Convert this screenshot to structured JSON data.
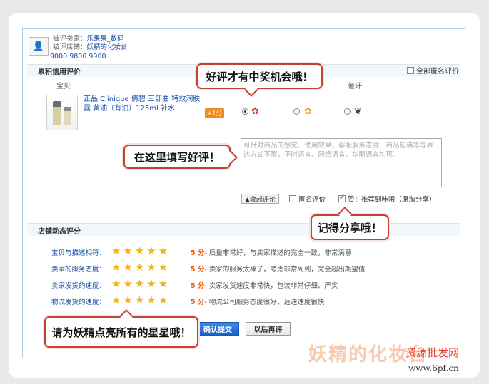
{
  "seller": {
    "seller_label": "被评卖家：",
    "seller_name": "乐果果_数码",
    "shop_label": "被评店铺：",
    "shop_name": "妖精的化妆台",
    "phones": "9000 9800 9900"
  },
  "credit_section": {
    "title": "累积信用评价",
    "anonymous_all": "全部匿名评价",
    "columns": [
      "宝贝",
      "差评"
    ]
  },
  "product": {
    "name": "正品 Clinique 倩碧 三部曲 特效润肤露 黄油（有油）125ml 补水",
    "bonus_badge": "+1分"
  },
  "review": {
    "placeholder": "可针对商品的感觉、使用效果、客服服务态度、商品包装等等表达方式不限，平时语言、网络语言、华丽语言均可.",
    "fold_button": "▲收起评论",
    "anonymous_label": "匿名评价",
    "share_label": "赞！推荐到哇哦（原淘分享）"
  },
  "dynamic_section": {
    "title": "店铺动态评分",
    "rows": [
      {
        "label": "宝贝与描述相符：",
        "score": "5 分",
        "desc": "- 质量非常好，与卖家描述的完全一致，非常满意"
      },
      {
        "label": "卖家的服务态度：",
        "score": "5 分",
        "desc": "- 卖家的服务太棒了，考虑非常周到，完全超出期望值"
      },
      {
        "label": "卖家发货的速度：",
        "score": "5 分",
        "desc": "- 卖家发货速度非常快，包装非常仔细、严实"
      },
      {
        "label": "物流发货的速度：",
        "score": "5 分",
        "desc": "- 物流公司服务态度很好，运送速度很快"
      }
    ],
    "stars_per_row": 5
  },
  "buttons": {
    "confirm": "确认提交",
    "later": "以后再评"
  },
  "callouts": {
    "top": "好评才有中奖机会哦！",
    "left": "在这里填写好评！",
    "share": "记得分享哦！",
    "stars": "请为妖精点亮所有的星星哦！"
  },
  "watermarks": {
    "brand": "妖精的化妆台",
    "site_cn": "资源批发网",
    "site_url": "www.6pf.cn"
  },
  "colors": {
    "link_blue": "#1a4fa6",
    "callout_red": "#c8402f",
    "star_gold": "#f3b21a",
    "score_orange": "#e8611a"
  }
}
